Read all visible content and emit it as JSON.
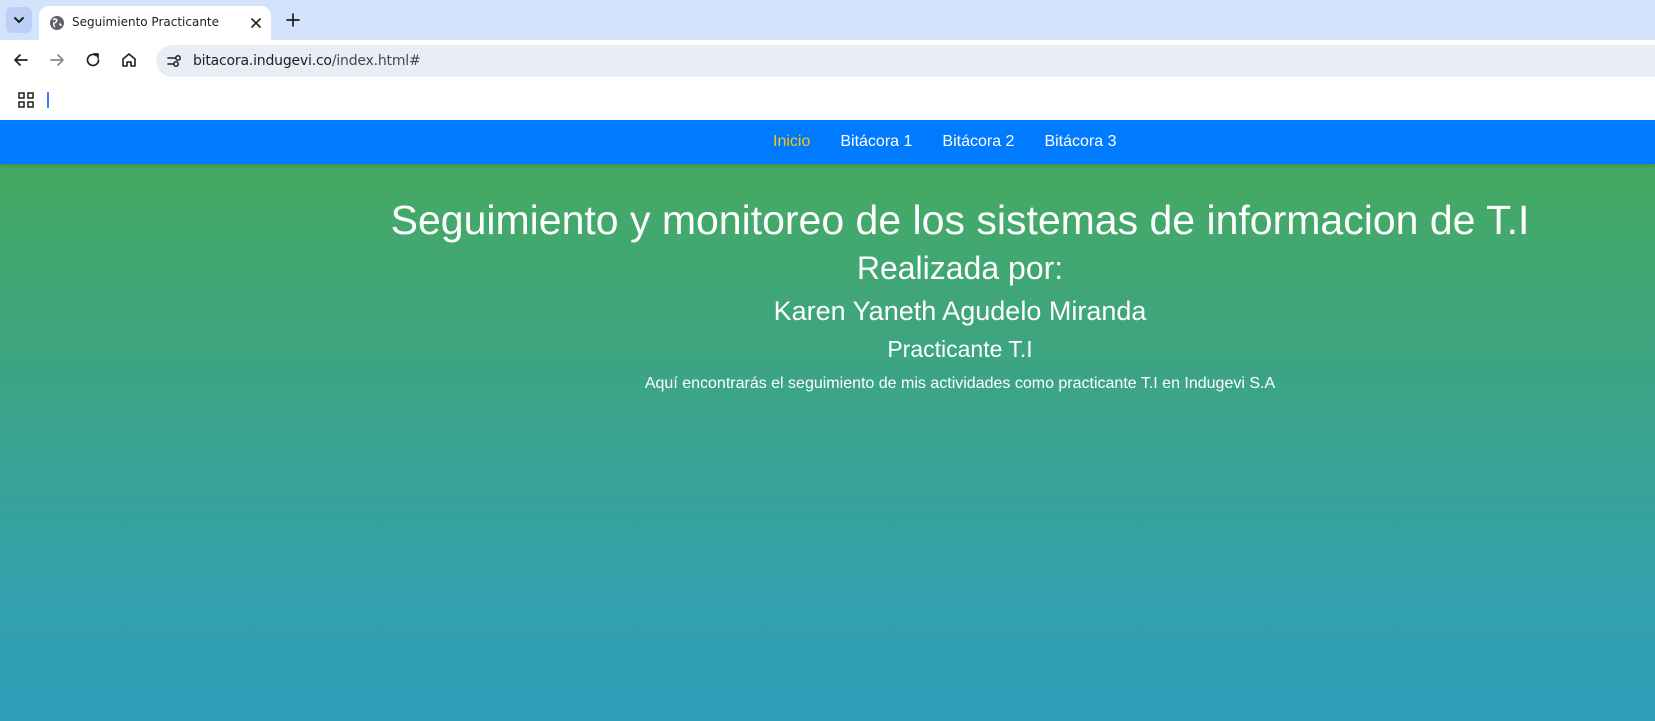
{
  "browser": {
    "tab": {
      "title": "Seguimiento Practicante",
      "favicon": "globe-icon"
    },
    "url": {
      "host": "bitacora.indugevi.co",
      "path": "/index.html#"
    },
    "icons": [
      "chevron-down-icon",
      "globe-icon",
      "close-icon",
      "plus-icon",
      "back-arrow-icon",
      "forward-arrow-icon",
      "reload-icon",
      "home-icon",
      "site-info-icon",
      "apps-grid-icon"
    ]
  },
  "nav": {
    "links": [
      {
        "label": "Inicio",
        "active": true
      },
      {
        "label": "Bitácora 1",
        "active": false
      },
      {
        "label": "Bitácora 2",
        "active": false
      },
      {
        "label": "Bitácora 3",
        "active": false
      }
    ],
    "bar_color": "#007bff",
    "active_color": "#ffc107"
  },
  "hero": {
    "title": "Seguimiento y monitoreo de los sistemas de informacion de T.I",
    "by_label": "Realizada por:",
    "name": "Karen Yaneth Agudelo Miranda",
    "role": "Practicante T.I",
    "description": "Aquí encontrarás el seguimiento de mis actividades como practicante T.I en Indugevi S.A"
  },
  "colors": {
    "gradient_top": "#48ab5a",
    "gradient_bottom": "#2f9fba",
    "tabbar": "#d3e3fd"
  }
}
